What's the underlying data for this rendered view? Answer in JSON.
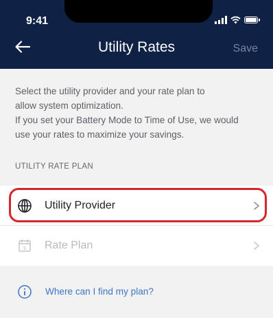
{
  "status_bar": {
    "time": "9:41"
  },
  "header": {
    "title": "Utility Rates",
    "save_label": "Save"
  },
  "description": {
    "line1": "Select the utility provider and your rate plan to",
    "line2": "allow system optimization.",
    "line3": "If you set your Battery Mode to Time of Use, we would",
    "line4": "use your rates to maximize your savings."
  },
  "section_label": "UTILITY RATE PLAN",
  "rows": {
    "provider": {
      "label": "Utility Provider",
      "icon": "globe-icon"
    },
    "rate_plan": {
      "label": "Rate Plan",
      "icon": "calendar-dollar-icon"
    }
  },
  "help_link": {
    "label": "Where can I find my plan?",
    "icon": "info-icon"
  },
  "colors": {
    "header_bg": "#0f2246",
    "highlight": "#d6262b",
    "link": "#3e74c7",
    "disabled_text": "#b7babe"
  }
}
